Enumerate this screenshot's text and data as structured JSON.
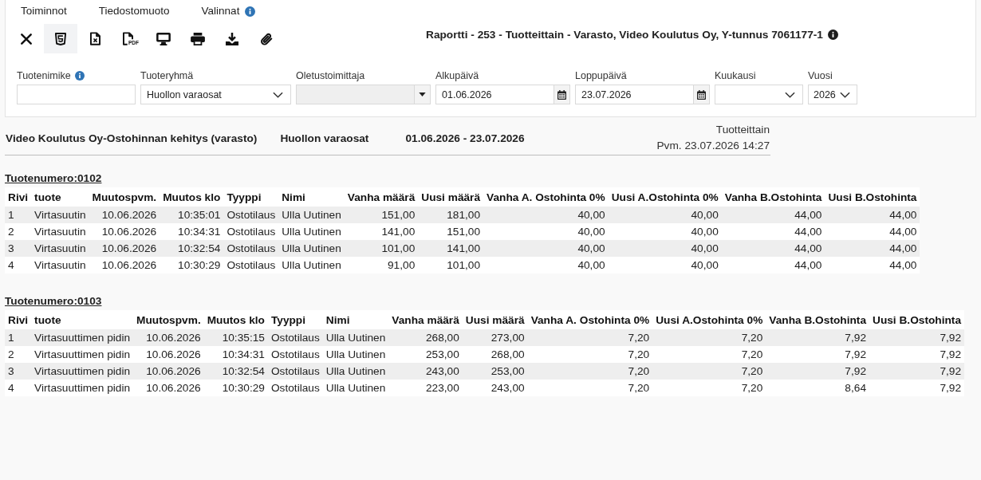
{
  "menu": [
    {
      "label": "Toiminnot",
      "info": false
    },
    {
      "label": "Tiedostomuoto",
      "info": false
    },
    {
      "label": "Valinnat",
      "info": true
    }
  ],
  "toolbar": [
    {
      "kind": "close",
      "selected": false
    },
    {
      "kind": "html",
      "selected": true
    },
    {
      "kind": "excel",
      "selected": false
    },
    {
      "kind": "pdf",
      "badge": "PDF",
      "selected": false
    },
    {
      "kind": "screen",
      "selected": false
    },
    {
      "kind": "print",
      "selected": false
    },
    {
      "kind": "download",
      "selected": false
    },
    {
      "kind": "attach",
      "selected": false
    }
  ],
  "report_title": {
    "text": "Raportti - 253 - Tuotteittain - Varasto, Video Koulutus Oy, Y-tunnus 7061177-1",
    "info": true
  },
  "filters": [
    {
      "label": "Tuotenimike",
      "info": true,
      "kind": "text",
      "disabled": false
    },
    {
      "label": "Tuoteryhmä",
      "info": false,
      "kind": "select",
      "value": "Huollon varaosat",
      "disabled": false
    },
    {
      "label": "Oletustoimittaja",
      "info": false,
      "kind": "combo",
      "disabled": true
    },
    {
      "label": "Alkupäivä",
      "info": false,
      "kind": "date",
      "value": "01.06.2026",
      "disabled": false
    },
    {
      "label": "Loppupäivä",
      "info": false,
      "kind": "date",
      "value": "23.07.2026",
      "disabled": false
    },
    {
      "label": "Kuukausi",
      "info": false,
      "kind": "select",
      "disabled": false
    },
    {
      "label": "Vuosi",
      "info": false,
      "kind": "select",
      "value": "2026",
      "disabled": false
    }
  ],
  "report": {
    "heading": "Video Koulutus Oy-Ostohinnan kehitys (varasto)",
    "group": "Huollon varaosat",
    "period": "01.06.2026 - 23.07.2026",
    "type": "Tuotteittain",
    "printed": "Pvm. 23.07.2026 14:27"
  },
  "sections": [
    {
      "title": "Tuotenumero:0102",
      "columns": [
        "Rivi",
        "tuote",
        "Muutospvm.",
        "Muutos klo",
        "Tyyppi",
        "Nimi",
        "Vanha määrä",
        "Uusi määrä",
        "Vanha A. Ostohinta 0%",
        "Uusi A.Ostohinta 0%",
        "Vanha B.Ostohinta",
        "Uusi B.Ostohinta"
      ],
      "rows": [
        [
          "1",
          "Virtasuutin",
          "10.06.2026",
          "10:35:01",
          "Ostotilaus",
          "Ulla Uutinen",
          "151,00",
          "181,00",
          "40,00",
          "40,00",
          "44,00",
          "44,00"
        ],
        [
          "2",
          "Virtasuutin",
          "10.06.2026",
          "10:34:31",
          "Ostotilaus",
          "Ulla Uutinen",
          "141,00",
          "151,00",
          "40,00",
          "40,00",
          "44,00",
          "44,00"
        ],
        [
          "3",
          "Virtasuutin",
          "10.06.2026",
          "10:32:54",
          "Ostotilaus",
          "Ulla Uutinen",
          "101,00",
          "141,00",
          "40,00",
          "40,00",
          "44,00",
          "44,00"
        ],
        [
          "4",
          "Virtasuutin",
          "10.06.2026",
          "10:30:29",
          "Ostotilaus",
          "Ulla Uutinen",
          "91,00",
          "101,00",
          "40,00",
          "40,00",
          "44,00",
          "44,00"
        ]
      ]
    },
    {
      "title": "Tuotenumero:0103",
      "columns": [
        "Rivi",
        "tuote",
        "Muutospvm.",
        "Muutos klo",
        "Tyyppi",
        "Nimi",
        "Vanha määrä",
        "Uusi määrä",
        "Vanha A. Ostohinta 0%",
        "Uusi A.Ostohinta 0%",
        "Vanha B.Ostohinta",
        "Uusi B.Ostohinta"
      ],
      "rows": [
        [
          "1",
          "Virtasuuttimen pidin",
          "10.06.2026",
          "10:35:15",
          "Ostotilaus",
          "Ulla Uutinen",
          "268,00",
          "273,00",
          "7,20",
          "7,20",
          "7,92",
          "7,92"
        ],
        [
          "2",
          "Virtasuuttimen pidin",
          "10.06.2026",
          "10:34:31",
          "Ostotilaus",
          "Ulla Uutinen",
          "253,00",
          "268,00",
          "7,20",
          "7,20",
          "7,92",
          "7,92"
        ],
        [
          "3",
          "Virtasuuttimen pidin",
          "10.06.2026",
          "10:32:54",
          "Ostotilaus",
          "Ulla Uutinen",
          "243,00",
          "253,00",
          "7,20",
          "7,20",
          "7,92",
          "7,92"
        ],
        [
          "4",
          "Virtasuuttimen pidin",
          "10.06.2026",
          "10:30:29",
          "Ostotilaus",
          "Ulla Uutinen",
          "223,00",
          "243,00",
          "7,20",
          "7,20",
          "8,64",
          "7,92"
        ]
      ]
    }
  ]
}
